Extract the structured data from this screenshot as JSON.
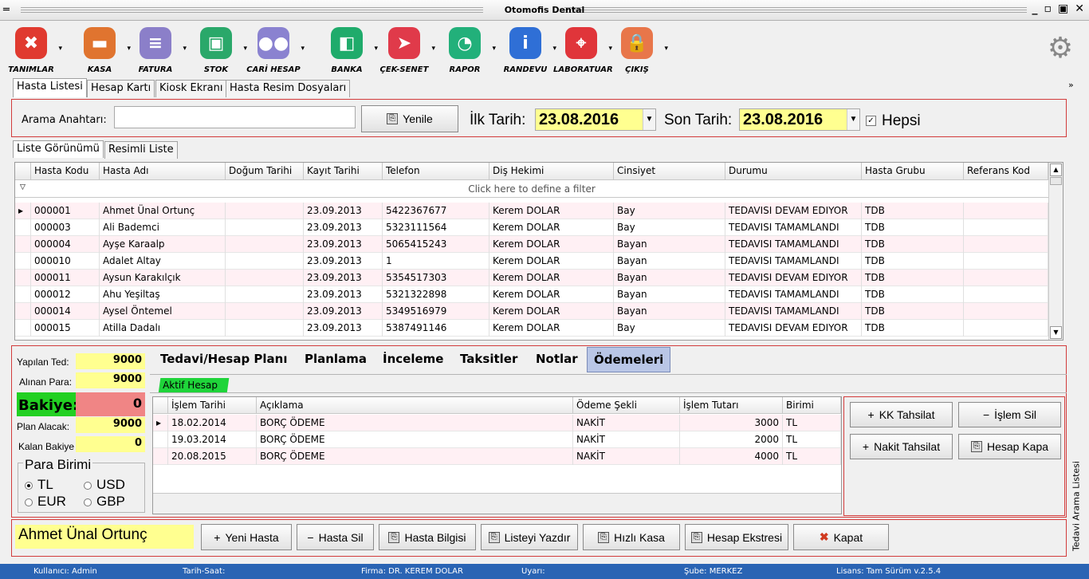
{
  "window": {
    "title": "Otomofis Dental"
  },
  "toolbar": {
    "items": [
      {
        "label": "TANIMLAR",
        "icon": "tools-icon",
        "color": "#e03a2f"
      },
      {
        "label": "KASA",
        "icon": "wallet-icon",
        "color": "#e0742f"
      },
      {
        "label": "FATURA",
        "icon": "document-icon",
        "color": "#8b7fc9"
      },
      {
        "label": "STOK",
        "icon": "briefcase-icon",
        "color": "#2aa86a"
      },
      {
        "label": "CARİ HESAP",
        "icon": "users-icon",
        "color": "#8a82d0"
      },
      {
        "label": "BANKA",
        "icon": "bag-icon",
        "color": "#1fab6b"
      },
      {
        "label": "ÇEK-SENET",
        "icon": "send-icon",
        "color": "#e03a4a"
      },
      {
        "label": "RAPOR",
        "icon": "pie-chart-icon",
        "color": "#22b07a"
      },
      {
        "label": "RANDEVU",
        "icon": "info-icon",
        "color": "#2f6fd6"
      },
      {
        "label": "LABORATUAR",
        "icon": "location-pin-icon",
        "color": "#e0353a"
      },
      {
        "label": "ÇIKIŞ",
        "icon": "lock-icon",
        "color": "#e8764a"
      }
    ]
  },
  "main_tabs": [
    "Hasta Listesi",
    "Hesap Kartı",
    "Kiosk Ekranı",
    "Hasta Resim Dosyaları"
  ],
  "search": {
    "label": "Arama Anahtarı:",
    "value": "",
    "refresh_label": "Yenile",
    "start_label": "İlk Tarih:",
    "start_date": "23.08.2016",
    "end_label": "Son Tarih:",
    "end_date": "23.08.2016",
    "all_label": "Hepsi",
    "all_checked": true
  },
  "view_tabs": [
    "Liste Görünümü",
    "Resimli Liste"
  ],
  "grid": {
    "columns": [
      "Hasta Kodu",
      "Hasta Adı",
      "Doğum Tarihi",
      "Kayıt Tarihi",
      "Telefon",
      "Diş Hekimi",
      "Cinsiyet",
      "Durumu",
      "Hasta Grubu",
      "Referans Kod"
    ],
    "filter_hint": "Click here to define a filter",
    "rows": [
      [
        "000001",
        "Ahmet Ünal Ortunç",
        "",
        "23.09.2013",
        "5422367677",
        "Kerem DOLAR",
        "Bay",
        "TEDAVISI DEVAM EDIYOR",
        "TDB",
        ""
      ],
      [
        "000003",
        "Ali Bademci",
        "",
        "23.09.2013",
        "5323111564",
        "Kerem DOLAR",
        "Bay",
        "TEDAVISI TAMAMLANDI",
        "TDB",
        ""
      ],
      [
        "000004",
        "Ayşe Karaalp",
        "",
        "23.09.2013",
        "5065415243",
        "Kerem DOLAR",
        "Bayan",
        "TEDAVISI TAMAMLANDI",
        "TDB",
        ""
      ],
      [
        "000010",
        "Adalet Altay",
        "",
        "23.09.2013",
        "1",
        "Kerem DOLAR",
        "Bayan",
        "TEDAVISI TAMAMLANDI",
        "TDB",
        ""
      ],
      [
        "000011",
        "Aysun Karakılçık",
        "",
        "23.09.2013",
        "5354517303",
        "Kerem DOLAR",
        "Bayan",
        "TEDAVISI DEVAM EDIYOR",
        "TDB",
        ""
      ],
      [
        "000012",
        "Ahu Yeşiltaş",
        "",
        "23.09.2013",
        "5321322898",
        "Kerem DOLAR",
        "Bayan",
        "TEDAVISI TAMAMLANDI",
        "TDB",
        ""
      ],
      [
        "000014",
        "Aysel Öntemel",
        "",
        "23.09.2013",
        "5349516979",
        "Kerem DOLAR",
        "Bayan",
        "TEDAVISI TAMAMLANDI",
        "TDB",
        ""
      ],
      [
        "000015",
        "Atilla Dadalı",
        "",
        "23.09.2013",
        "5387491146",
        "Kerem DOLAR",
        "Bay",
        "TEDAVISI DEVAM EDIYOR",
        "TDB",
        ""
      ]
    ]
  },
  "summary": {
    "done_label": "Yapılan Ted:",
    "done_value": "9000",
    "received_label": "Alınan Para:",
    "received_value": "9000",
    "balance_label": "Bakiye:",
    "balance_value": "0",
    "plan_label": "Plan Alacak:",
    "plan_value": "9000",
    "remaining_label": "Kalan Bakiye",
    "remaining_value": "0",
    "currency_title": "Para Birimi",
    "currencies": [
      "TL",
      "USD",
      "EUR",
      "GBP"
    ],
    "selected_currency": "TL"
  },
  "panel_tabs": [
    "Tedavi/Hesap Planı",
    "Planlama",
    "İnceleme",
    "Taksitler",
    "Notlar",
    "Ödemeleri"
  ],
  "active_account_tab": "Aktif Hesap",
  "payments": {
    "columns": [
      "İşlem Tarihi",
      "Açıklama",
      "Ödeme Şekli",
      "İşlem Tutarı",
      "Birimi"
    ],
    "rows": [
      [
        "18.02.2014",
        "BORÇ ÖDEME",
        "NAKİT",
        "3000",
        "TL"
      ],
      [
        "19.03.2014",
        "BORÇ ÖDEME",
        "NAKİT",
        "2000",
        "TL"
      ],
      [
        "20.08.2015",
        "BORÇ ÖDEME",
        "NAKİT",
        "4000",
        "TL"
      ]
    ]
  },
  "payment_actions": {
    "kk": "KK Tahsilat",
    "delete": "İşlem Sil",
    "cash": "Nakit Tahsilat",
    "close_account": "Hesap Kapa"
  },
  "side_tab": "Tedavi Arama Listesi",
  "footer": {
    "patient_name": "Ahmet Ünal Ortunç",
    "buttons": [
      "Yeni Hasta",
      "Hasta Sil",
      "Hasta Bilgisi",
      "Listeyi Yazdır",
      "Hızlı Kasa",
      "Hesap Ekstresi",
      "Kapat"
    ]
  },
  "status": {
    "user": "Kullanıcı: Admin",
    "datetime": "Tarih-Saat:",
    "firm": "Firma: DR. KEREM DOLAR",
    "warning": "Uyarı:",
    "branch": "Şube: MERKEZ",
    "license": "Lisans: Tam Sürüm v.2.5.4"
  }
}
